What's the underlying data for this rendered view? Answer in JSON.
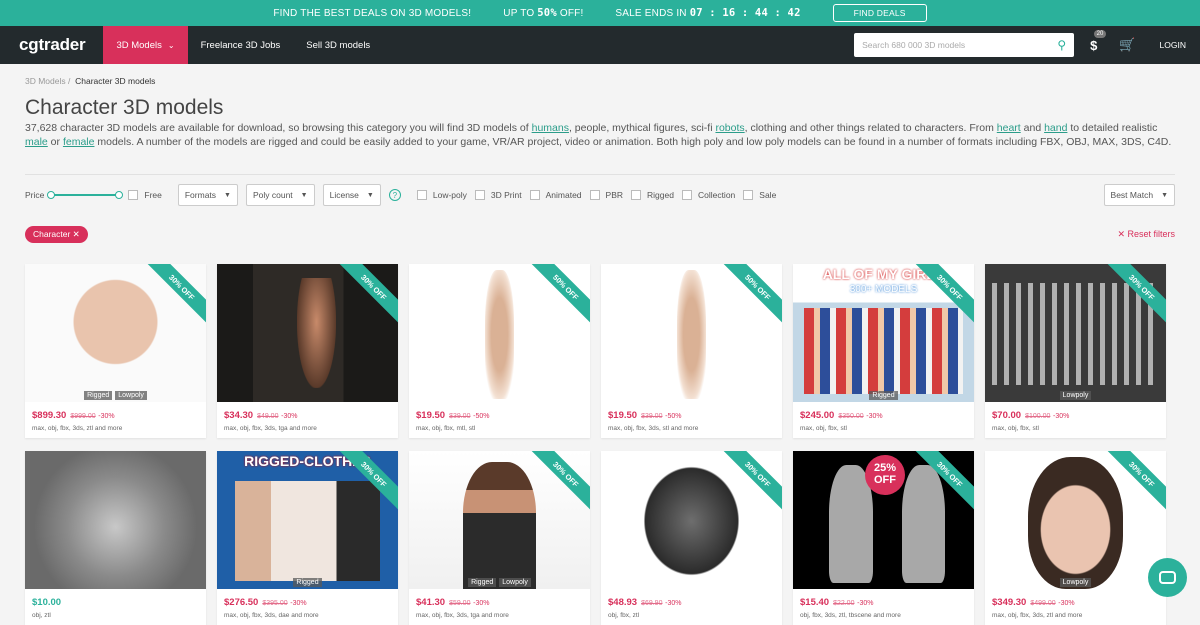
{
  "promo": {
    "text1": "FIND THE BEST DEALS ON 3D MODELS!",
    "upto": "UP TO",
    "pct": "50%",
    "off": "OFF!",
    "ends": "SALE ENDS IN",
    "timer": "07 : 16 : 44 : 42",
    "button": "FIND DEALS"
  },
  "nav": {
    "logo": "cgtrader",
    "items": [
      "3D Models",
      "Freelance 3D Jobs",
      "Sell 3D models"
    ],
    "search_placeholder": "Search 680 000 3D models",
    "badge": "20",
    "login": "LOGIN"
  },
  "breadcrumb": {
    "root": "3D Models",
    "sep": "/",
    "current": "Character 3D models"
  },
  "title": "Character 3D models",
  "desc": {
    "p1": "37,628 character 3D models are available for download, so browsing this category you will find 3D models of ",
    "l1": "humans",
    "p2": ", people, mythical figures, sci-fi ",
    "l2": "robots",
    "p3": ", clothing and other things related to characters. From ",
    "l3": "heart",
    "p4": " and ",
    "l4": "hand",
    "p5": " to detailed realistic ",
    "l5": "male",
    "p6": " or ",
    "l6": "female",
    "p7": " models. A number of the models are rigged and could be easily added to your game, VR/AR project, video or animation. Both high poly and low poly models can be found in a number of formats including FBX, OBJ, MAX, 3DS, C4D."
  },
  "filters": {
    "price": "Price",
    "free": "Free",
    "formats": "Formats",
    "poly": "Poly count",
    "license": "License",
    "help": "?",
    "checks": [
      "Low-poly",
      "3D Print",
      "Animated",
      "PBR",
      "Rigged",
      "Collection",
      "Sale"
    ],
    "sort": "Best Match"
  },
  "active_tag": "Character ✕",
  "reset": "✕ Reset filters",
  "cards": [
    {
      "ribbon": "30% OFF",
      "tags": [
        "Rigged",
        "Lowpoly"
      ],
      "price": "$899.30",
      "old": "$999.00",
      "disc": "-30%",
      "formats": "max, obj, fbx, 3ds, ztl and more"
    },
    {
      "ribbon": "30% OFF",
      "tags": [],
      "price": "$34.30",
      "old": "$49.00",
      "disc": "-30%",
      "formats": "max, obj, fbx, 3ds, tga and more"
    },
    {
      "ribbon": "50% OFF",
      "tags": [],
      "price": "$19.50",
      "old": "$39.00",
      "disc": "-50%",
      "formats": "max, obj, fbx, mtl, stl"
    },
    {
      "ribbon": "50% OFF",
      "tags": [],
      "price": "$19.50",
      "old": "$39.00",
      "disc": "-50%",
      "formats": "max, obj, fbx, 3ds, stl and more"
    },
    {
      "ribbon": "30% OFF",
      "tags": [
        "Rigged"
      ],
      "price": "$245.00",
      "old": "$350.00",
      "disc": "-30%",
      "formats": "max, obj, fbx, stl",
      "banner": "ALL OF MY GIRLS",
      "banner2": "300+ MODELS"
    },
    {
      "ribbon": "30% OFF",
      "tags": [
        "Lowpoly"
      ],
      "price": "$70.00",
      "old": "$100.00",
      "disc": "-30%",
      "formats": "max, obj, fbx, stl"
    },
    {
      "ribbon": "",
      "tags": [],
      "price": "$10.00",
      "old": "",
      "disc": "",
      "formats": "obj, ztl",
      "free": true
    },
    {
      "ribbon": "30% OFF",
      "tags": [
        "Rigged"
      ],
      "price": "$276.50",
      "old": "$395.00",
      "disc": "-30%",
      "formats": "max, obj, fbx, 3ds, dae and more",
      "banner": "RIGGED-CLOTHES"
    },
    {
      "ribbon": "30% OFF",
      "tags": [
        "Rigged",
        "Lowpoly"
      ],
      "price": "$41.30",
      "old": "$59.00",
      "disc": "-30%",
      "formats": "max, obj, fbx, 3ds, tga and more"
    },
    {
      "ribbon": "30% OFF",
      "tags": [],
      "price": "$48.93",
      "old": "$69.90",
      "disc": "-30%",
      "formats": "obj, fbx, ztl"
    },
    {
      "ribbon": "30% OFF",
      "tags": [],
      "price": "$15.40",
      "old": "$22.00",
      "disc": "-30%",
      "formats": "obj, fbx, 3ds, ztl, tbscene and more",
      "sale": "25% OFF"
    },
    {
      "ribbon": "30% OFF",
      "tags": [
        "Lowpoly"
      ],
      "price": "$349.30",
      "old": "$499.00",
      "disc": "-30%",
      "formats": "max, obj, fbx, 3ds, ztl and more"
    }
  ]
}
